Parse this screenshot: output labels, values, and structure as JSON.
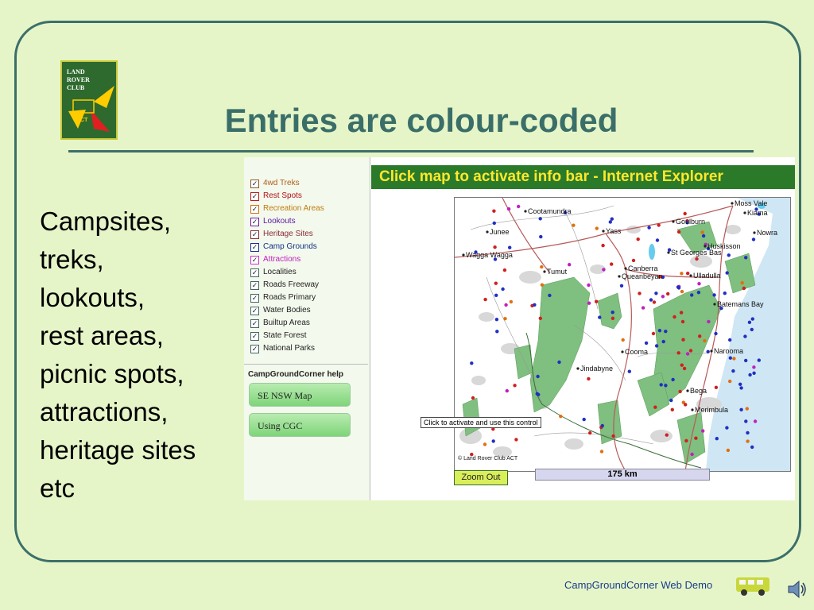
{
  "slide": {
    "title": "Entries are colour-coded",
    "logo": {
      "text": "LAND\nROVER\nCLUB",
      "badge": "ACT"
    },
    "bullets": [
      "Campsites,",
      "treks,",
      "lookouts,",
      "rest areas,",
      "picnic spots,",
      "attractions,",
      "heritage sites",
      "etc"
    ],
    "footer": "CampGroundCorner Web Demo",
    "colors": {
      "title": "#3a6e69",
      "frame": "#3c6f6a",
      "background": "#e6f5c8"
    }
  },
  "app": {
    "layers": [
      {
        "label": "4wd Treks",
        "color": "#b05b1a",
        "box": "#8a5a2a"
      },
      {
        "label": "Rest Spots",
        "color": "#b3101a",
        "box": "#c01818"
      },
      {
        "label": "Recreation Areas",
        "color": "#c07a10",
        "box": "#d07010"
      },
      {
        "label": "Lookouts",
        "color": "#5a1aa0",
        "box": "#6a1aa0"
      },
      {
        "label": "Heritage Sites",
        "color": "#8a2a3a",
        "box": "#8a2a3a"
      },
      {
        "label": "Camp Grounds",
        "color": "#10308a",
        "box": "#1030a0"
      },
      {
        "label": "Attractions",
        "color": "#c020c0",
        "box": "#d030d0"
      },
      {
        "label": "Localities",
        "color": "#222222",
        "box": "#446666"
      },
      {
        "label": "Roads Freeway",
        "color": "#222222",
        "box": "#446666"
      },
      {
        "label": "Roads Primary",
        "color": "#222222",
        "box": "#446666"
      },
      {
        "label": "Water Bodies",
        "color": "#222222",
        "box": "#446666"
      },
      {
        "label": "Builtup Areas",
        "color": "#222222",
        "box": "#446666"
      },
      {
        "label": "State Forest",
        "color": "#222222",
        "box": "#446666"
      },
      {
        "label": "National Parks",
        "color": "#222222",
        "box": "#446666"
      }
    ],
    "check_mark": "✓",
    "help_title": "CampGroundCorner help",
    "help_buttons": [
      "SE NSW Map",
      "Using CGC"
    ],
    "map_header": "Click map to activate info bar - Internet Explorer",
    "tooltip": "Click to activate and use this control",
    "zoom_out": "Zoom Out",
    "scale": "175 km",
    "copyright": "© Land Rover Club ACT",
    "places": [
      "Moss Vale",
      "Kiama",
      "Cootamundra",
      "Goulburn",
      "Nowra",
      "Junee",
      "Yass",
      "Wagga Wagga",
      "Huskisson",
      "St Georges Bas",
      "Tumut",
      "Canberra",
      "Queanbeyan",
      "Ulladulla",
      "Batemans Bay",
      "Cooma",
      "Narooma",
      "Jindabyne",
      "Bega",
      "Merimbula"
    ]
  }
}
